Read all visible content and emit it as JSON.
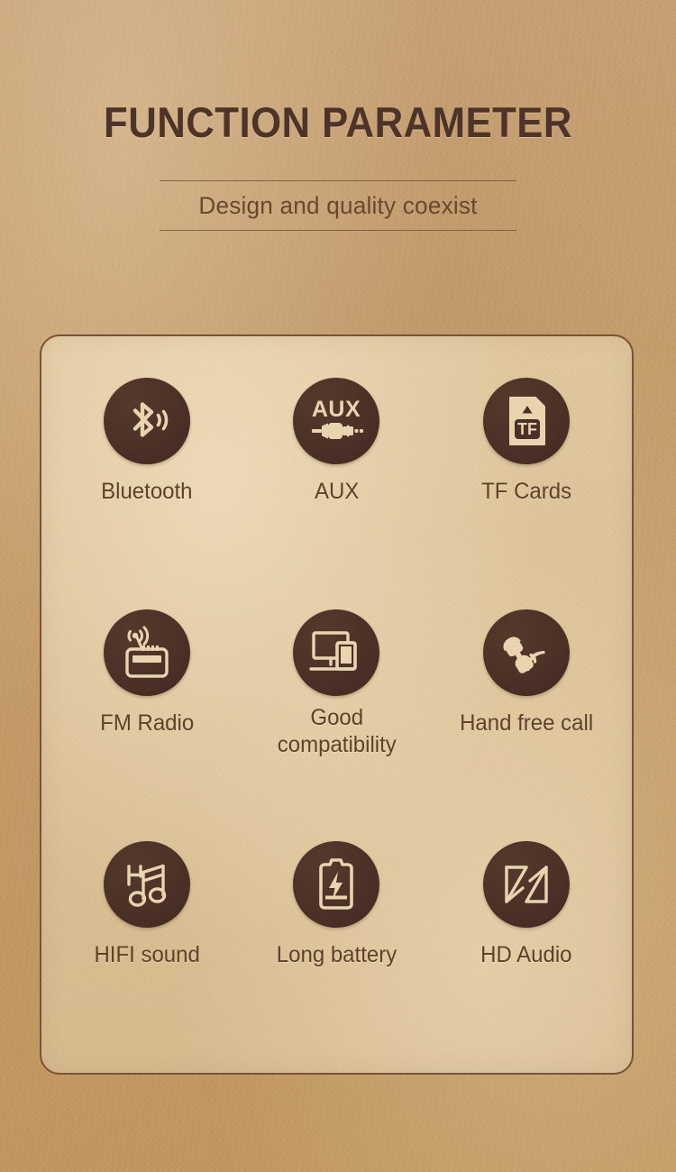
{
  "header": {
    "title": "FUNCTION PARAMETER",
    "subtitle": "Design and quality coexist"
  },
  "colors": {
    "background_kraft": "#c8a071",
    "card_background": "#dcc196",
    "card_border": "#7a5336",
    "badge_circle": "#4a3026",
    "icon_cream": "#e8d5b0",
    "title_brown": "#4d3328",
    "label_brown": "#5e4129"
  },
  "features": [
    {
      "label": "Bluetooth",
      "icon": "bluetooth-icon"
    },
    {
      "label": "AUX",
      "icon": "aux-jack-icon"
    },
    {
      "label": "TF Cards",
      "icon": "tf-card-icon",
      "icon_text": "TF"
    },
    {
      "label": "FM Radio",
      "icon": "fm-radio-icon"
    },
    {
      "label": "Good\ncompatibility",
      "icon": "devices-compatibility-icon"
    },
    {
      "label": "Hand free call",
      "icon": "handset-call-icon"
    },
    {
      "label": "HIFI sound",
      "icon": "hifi-music-note-icon"
    },
    {
      "label": "Long battery",
      "icon": "battery-charge-icon"
    },
    {
      "label": "HD Audio",
      "icon": "hd-audio-icon"
    }
  ],
  "icon_labels": {
    "aux_text": "AUX",
    "tf_text": "TF"
  }
}
